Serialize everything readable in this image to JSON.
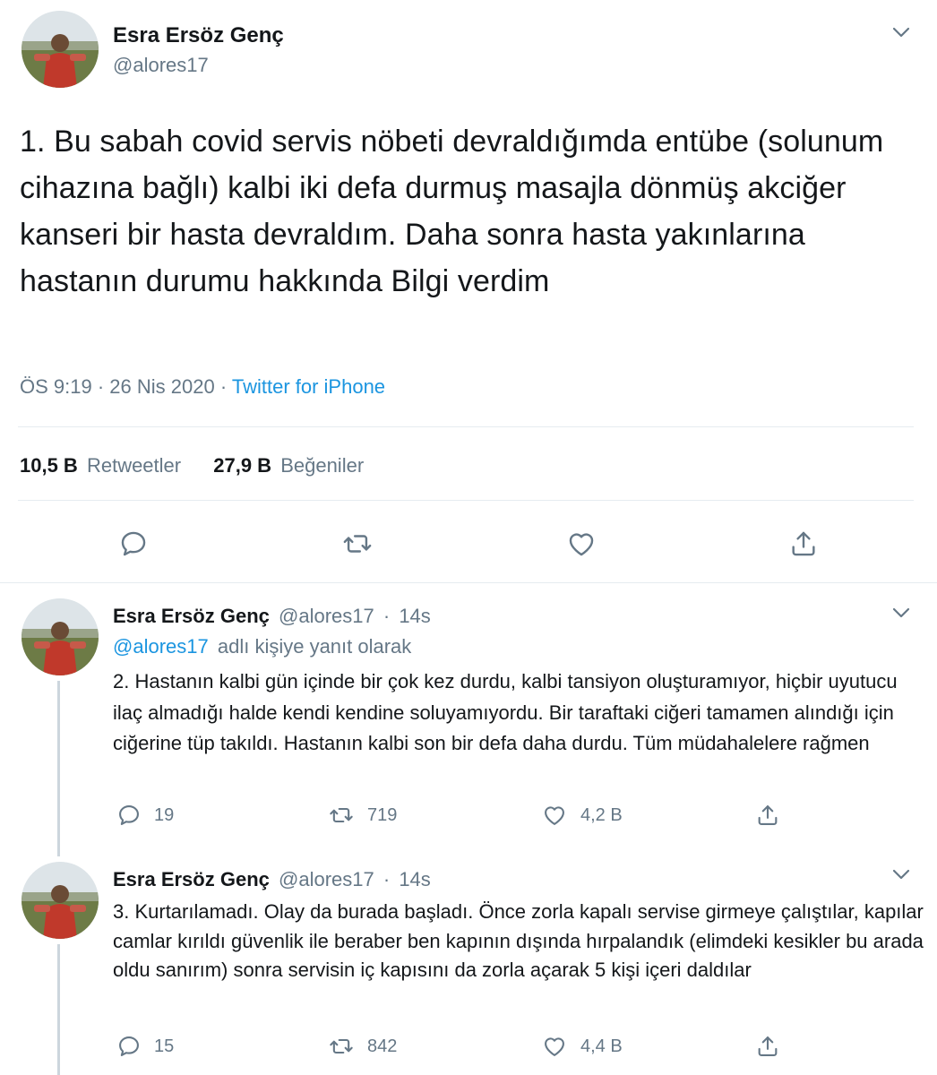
{
  "main_tweet": {
    "author_name": "Esra Ersöz Genç",
    "handle": "@alores17",
    "text": "1. Bu sabah covid servis nöbeti devraldığımda entübe (solunum cihazına bağlı) kalbi iki defa durmuş masajla dönmüş akciğer kanseri bir hasta devraldım. Daha sonra hasta yakınlarına hastanın durumu hakkında Bilgi verdim",
    "time": "ÖS 9:19",
    "separator": " · ",
    "date": "26 Nis 2020",
    "source": "Twitter for iPhone",
    "retweet_count": "10,5 B",
    "retweet_label": "Retweetler",
    "like_count": "27,9 B",
    "like_label": "Beğeniler"
  },
  "replies": [
    {
      "author_name": "Esra Ersöz Genç",
      "handle": "@alores17",
      "dot": "·",
      "age": "14s",
      "reply_to_handle": "@alores17",
      "reply_to_suffix": "adlı kişiye yanıt olarak",
      "text": "2. Hastanın kalbi gün içinde bir çok kez durdu, kalbi tansiyon oluşturamıyor, hiçbir uyutucu ilaç almadığı halde kendi kendine soluyamıyordu. Bir taraftaki ciğeri tamamen alındığı için ciğerine tüp takıldı. Hastanın  kalbi son bir defa daha durdu. Tüm müdahalelere rağmen",
      "replies": "19",
      "retweets": "719",
      "likes": "4,2 B"
    },
    {
      "author_name": "Esra Ersöz Genç",
      "handle": "@alores17",
      "dot": "·",
      "age": "14s",
      "text": "3. Kurtarılamadı. Olay da burada başladı. Önce zorla kapalı servise girmeye çalıştılar, kapılar camlar kırıldı güvenlik ile beraber ben kapının dışında hırpalandık (elimdeki kesikler bu arada oldu sanırım) sonra servisin iç kapısını da zorla açarak 5 kişi içeri daldılar",
      "replies": "15",
      "retweets": "842",
      "likes": "4,4 B"
    }
  ],
  "icons": {
    "caret": "chevron-down-icon",
    "reply": "reply-icon",
    "retweet": "retweet-icon",
    "like": "heart-icon",
    "share": "share-icon"
  },
  "colors": {
    "text": "#14171a",
    "muted": "#657786",
    "link": "#1b95e0",
    "divider": "#e6ecf0",
    "thread_line": "#ccd6dd"
  }
}
